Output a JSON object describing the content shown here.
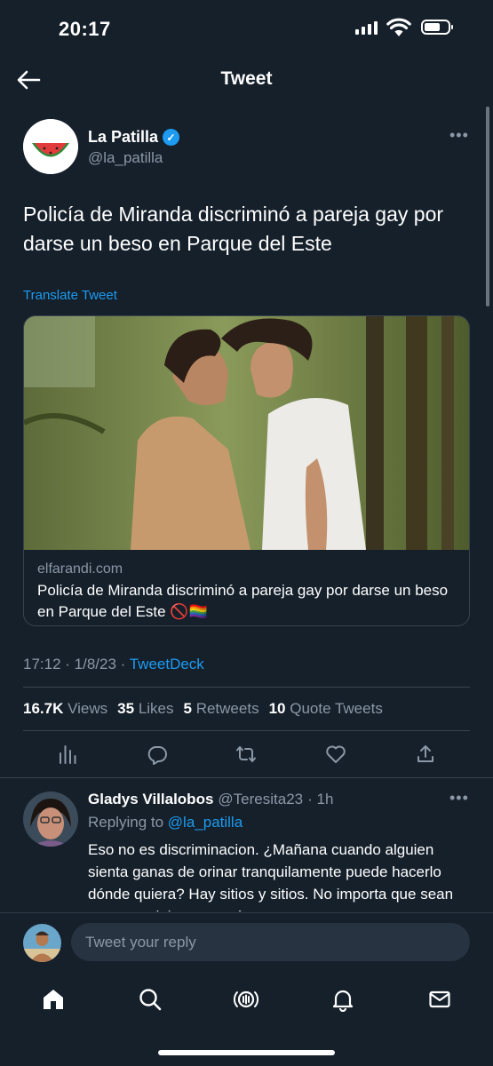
{
  "status_bar": {
    "time": "20:17"
  },
  "header": {
    "title": "Tweet"
  },
  "tweet": {
    "author_name": "La Patilla",
    "author_handle": "@la_patilla",
    "text": "Policía de Miranda discriminó a pareja gay por darse un beso en Parque del Este",
    "translate_label": "Translate Tweet",
    "card": {
      "domain": "elfarandi.com",
      "title": "Policía de Miranda discriminó a pareja gay por darse un beso en Parque del Este 🚫🏳️‍🌈"
    },
    "timestamp": "17:12 · 1/8/23 · ",
    "source": "TweetDeck",
    "stats": {
      "views_count": "16.7K",
      "views_label": "Views",
      "likes_count": "35",
      "likes_label": "Likes",
      "retweets_count": "5",
      "retweets_label": "Retweets",
      "quotes_count": "10",
      "quotes_label": "Quote Tweets"
    }
  },
  "reply": {
    "name": "Gladys Villalobos",
    "handle": "@Teresita23",
    "time": "· 1h",
    "replying_label": "Replying to",
    "replying_handle": "@la_patilla",
    "text": "Eso no es discriminacion. ¿Mañana cuando alguien sienta ganas de orinar tranquilamente puede hacerlo dónde quiera? Hay sitios y sitios. No  importa que sean gay pero deben ser más respetuosos con"
  },
  "compose": {
    "placeholder": "Tweet your reply"
  },
  "colors": {
    "background": "#15202b",
    "accent": "#1d9bf0",
    "muted": "#8b98a5",
    "border": "#38444d"
  },
  "icons": [
    "back-arrow-icon",
    "verified-icon",
    "more-icon",
    "views-icon",
    "reply-icon",
    "retweet-icon",
    "like-icon",
    "share-icon",
    "home-icon",
    "search-icon",
    "spaces-icon",
    "notifications-icon",
    "messages-icon"
  ]
}
